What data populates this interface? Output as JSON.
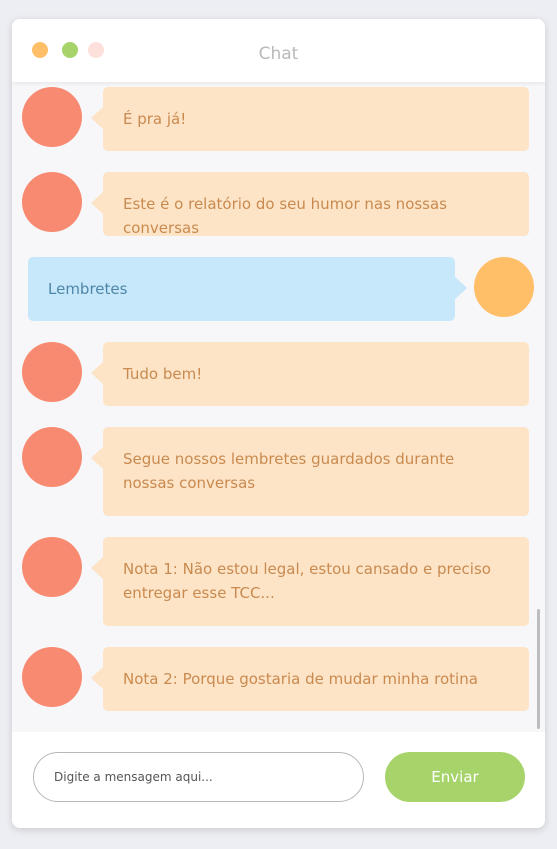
{
  "window": {
    "title": "Chat",
    "controls": [
      {
        "name": "close",
        "color": "#ffbf69"
      },
      {
        "name": "minimize",
        "color": "#a6d46a"
      },
      {
        "name": "maximize",
        "color": "#fde0dc"
      }
    ]
  },
  "colors": {
    "bot_avatar": "#f88a72",
    "user_avatar": "#ffbf69",
    "bot_bubble": "#fde4c7",
    "user_bubble": "#c6e8fa",
    "send_button": "#a6d46a"
  },
  "messages": [
    {
      "sender": "bot",
      "text": "É pra já!"
    },
    {
      "sender": "bot",
      "text": "Este é o relatório do seu humor nas nossas conversas"
    },
    {
      "sender": "user",
      "text": "Lembretes"
    },
    {
      "sender": "bot",
      "text": "Tudo bem!"
    },
    {
      "sender": "bot",
      "text": "Segue nossos lembretes guardados durante nossas conversas"
    },
    {
      "sender": "bot",
      "text": "Nota 1: Não estou legal, estou cansado e preciso entregar esse TCC..."
    },
    {
      "sender": "bot",
      "text": "Nota 2: Porque gostaria de mudar minha rotina"
    }
  ],
  "composer": {
    "placeholder": "Digite a mensagem aqui...",
    "value": "",
    "send_label": "Enviar"
  }
}
